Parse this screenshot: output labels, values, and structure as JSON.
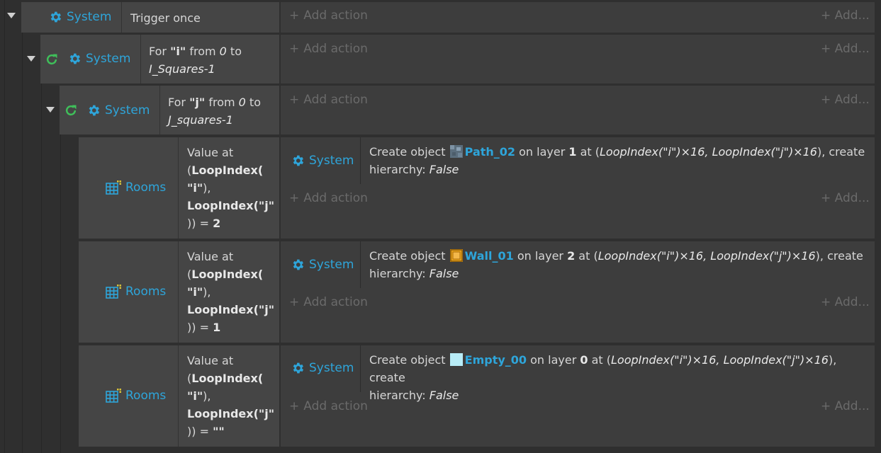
{
  "system_label": "System",
  "rooms_label": "Rooms",
  "add_action_label": "Add action",
  "add_right_label": "Add...",
  "events": [
    {
      "condition_object": "System",
      "condition_text": "Trigger once"
    },
    {
      "condition_object": "System",
      "for_prefix": "For ",
      "for_var": "\"i\"",
      "for_from": " from ",
      "for_start": "0",
      "for_to": " to",
      "for_end": "I_Squares-1"
    },
    {
      "condition_object": "System",
      "for_prefix": "For ",
      "for_var": "\"j\"",
      "for_from": " from ",
      "for_start": "0",
      "for_to": " to",
      "for_end": "J_squares-1"
    }
  ],
  "rooms_events": [
    {
      "cond_line1": "Value at",
      "cond_line2a": "(",
      "cond_line2b": "LoopIndex(",
      "cond_line3": "\"i\"",
      "cond_line3b": "),",
      "cond_line4": "LoopIndex(\"j\"",
      "cond_line5a": ")) = ",
      "cond_line5b": "2",
      "action_create": "Create object ",
      "action_object": "Path_02",
      "action_layer_pre": " on layer ",
      "action_layer": "1",
      "action_at": " at (",
      "action_expr": "LoopIndex(\"i\")×16, LoopIndex(\"j\")×16",
      "action_tail": "), create",
      "action_hier": "hierarchy: ",
      "action_hier_val": "False"
    },
    {
      "cond_line1": "Value at",
      "cond_line2a": "(",
      "cond_line2b": "LoopIndex(",
      "cond_line3": "\"i\"",
      "cond_line3b": "),",
      "cond_line4": "LoopIndex(\"j\"",
      "cond_line5a": ")) = ",
      "cond_line5b": "1",
      "action_create": "Create object ",
      "action_object": "Wall_01",
      "action_layer_pre": " on layer ",
      "action_layer": "2",
      "action_at": " at (",
      "action_expr": "LoopIndex(\"i\")×16, LoopIndex(\"j\")×16",
      "action_tail": "), create",
      "action_hier": "hierarchy: ",
      "action_hier_val": "False"
    },
    {
      "cond_line1": "Value at",
      "cond_line2a": "(",
      "cond_line2b": "LoopIndex(",
      "cond_line3": "\"i\"",
      "cond_line3b": "),",
      "cond_line4": "LoopIndex(\"j\"",
      "cond_line5a": ")) = ",
      "cond_line5b": "\"\"",
      "action_create": "Create object ",
      "action_object": "Empty_00",
      "action_layer_pre": " on layer ",
      "action_layer": "0",
      "action_at": " at (",
      "action_expr": "LoopIndex(\"i\")×16, LoopIndex(\"j\")×16",
      "action_tail": "), create",
      "action_hier": "hierarchy: ",
      "action_hier_val": "False"
    }
  ],
  "colors": {
    "accent": "#2ea5da",
    "loop_green": "#3fbf5a",
    "condition_bg": "#454545",
    "action_bg": "#3d3d3d",
    "sheet_bg": "#2f2f2f"
  }
}
